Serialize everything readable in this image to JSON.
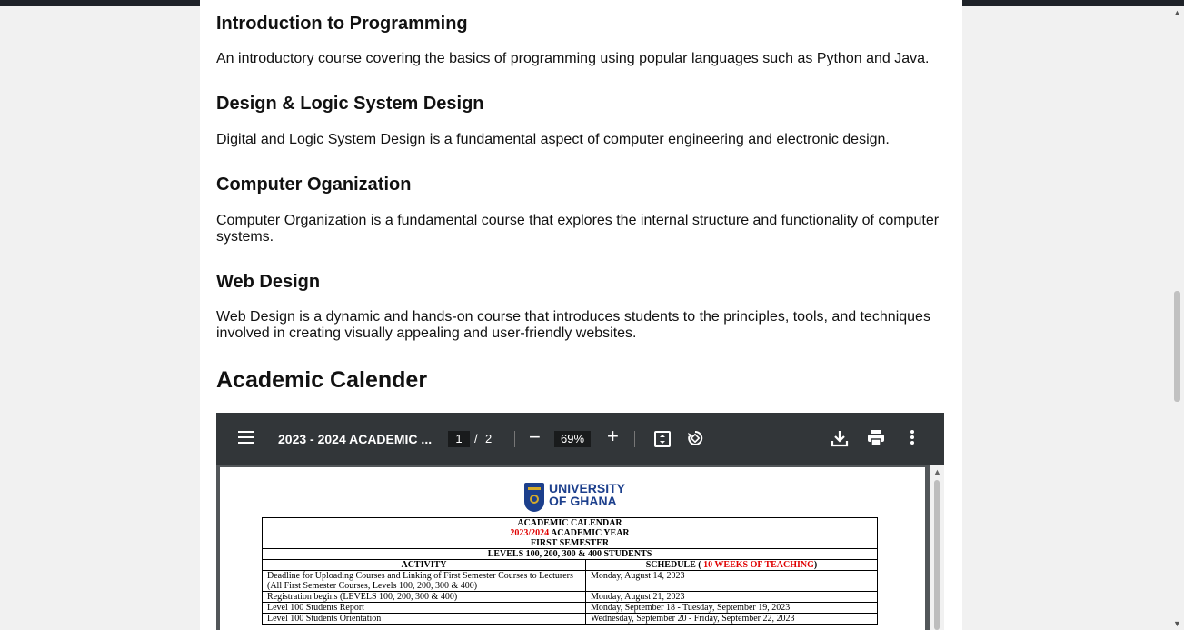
{
  "courses": [
    {
      "title": "Introduction to Programming",
      "desc": "An introductory course covering the basics of programming using popular languages such as Python and Java."
    },
    {
      "title": "Design & Logic System Design",
      "desc": "Digital and Logic System Design is a fundamental aspect of computer engineering and electronic design."
    },
    {
      "title": "Computer Oganization",
      "desc": "Computer Organization is a fundamental course that explores the internal structure and functionality of computer systems."
    },
    {
      "title": "Web Design",
      "desc": "Web Design is a dynamic and hands-on course that introduces students to the principles, tools, and techniques involved in creating visually appealing and user-friendly websites."
    }
  ],
  "section": {
    "title": "Academic Calender"
  },
  "pdf_viewer": {
    "doc_title": "2023 - 2024 ACADEMIC ...",
    "current_page": "1",
    "page_sep": "/",
    "total_pages": "2",
    "zoom_out": "−",
    "zoom": "69%",
    "zoom_in": "+",
    "icons": [
      "menu-icon",
      "fit-page-icon",
      "rotate-icon",
      "download-icon",
      "print-icon",
      "more-options-icon"
    ]
  },
  "document": {
    "logo_line1": "UNIVERSITY",
    "logo_line2": "OF GHANA",
    "heading1": "ACADEMIC CALENDAR",
    "year_red": "2023/2024",
    "year_rest": " ACADEMIC YEAR",
    "semester": "FIRST SEMESTER",
    "levels": "LEVELS 100, 200, 300 & 400 STUDENTS",
    "col_activity": "ACTIVITY",
    "col_schedule_pre": "SCHEDULE ( ",
    "col_schedule_red": "10 WEEKS OF TEACHING",
    "col_schedule_post": ")",
    "rows": [
      {
        "activity": "Deadline for Uploading  Courses and Linking of First Semester Courses to Lecturers (All First Semester Courses, Levels 100, 200, 300 & 400)",
        "schedule": "Monday, August 14, 2023"
      },
      {
        "activity": "Registration begins (LEVELS 100, 200, 300 & 400)",
        "schedule": "Monday, August 21, 2023"
      },
      {
        "activity": "Level 100 Students Report",
        "schedule": "Monday, September 18 - Tuesday, September 19, 2023"
      },
      {
        "activity": "Level 100 Students Orientation",
        "schedule": "Wednesday, September 20 - Friday, September 22, 2023"
      }
    ]
  },
  "colors": {
    "page_bg": "#f1f1f1",
    "viewer_toolbar": "#323639",
    "viewer_bg": "#525659",
    "accent_red": "#e00000",
    "uog_blue": "#1c3f8c"
  }
}
